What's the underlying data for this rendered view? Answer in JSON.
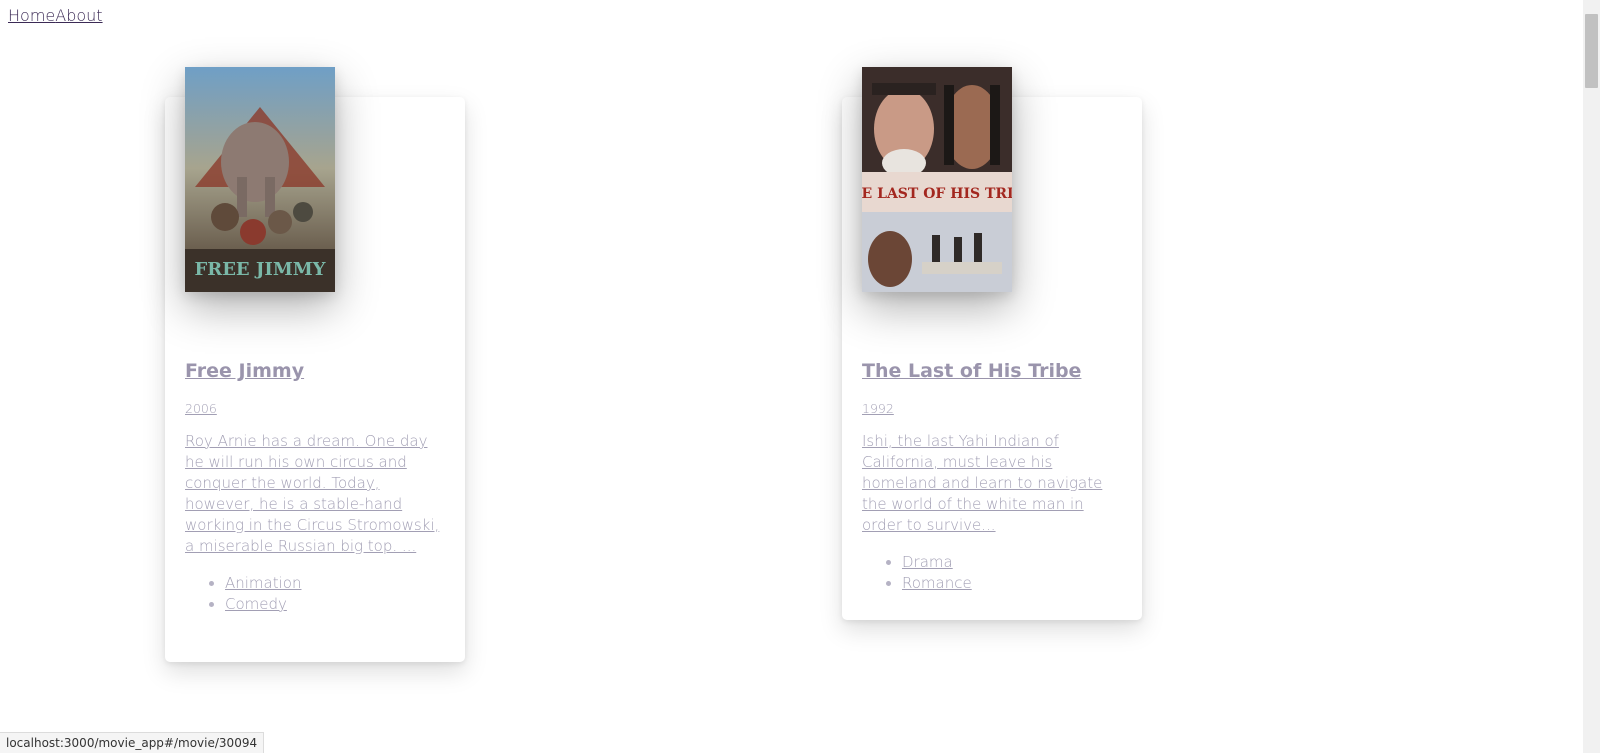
{
  "nav": {
    "home_label": "Home",
    "about_label": "About"
  },
  "movies": [
    {
      "title": "Free Jimmy",
      "year": "2006",
      "summary": "Roy Arnie has a dream. One day he will run his own circus and conquer the world. Today, however, he is a stable-hand working in the Circus Stromowski, a miserable Russian big top. ...",
      "genres": [
        "Animation",
        "Comedy"
      ],
      "poster_text": "FREE JIMMY"
    },
    {
      "title": "The Last of His Tribe",
      "year": "1992",
      "summary": "Ishi, the last Yahi Indian of California, must leave his homeland and learn to navigate the world of the white man in order to survive...",
      "genres": [
        "Drama",
        "Romance"
      ],
      "poster_text": "THE LAST OF HIS TRIBE"
    }
  ],
  "status_bar": {
    "url": "localhost:3000/movie_app#/movie/30094"
  },
  "colors": {
    "link_muted": "#a29fb4",
    "nav_link": "#3b2a55"
  }
}
